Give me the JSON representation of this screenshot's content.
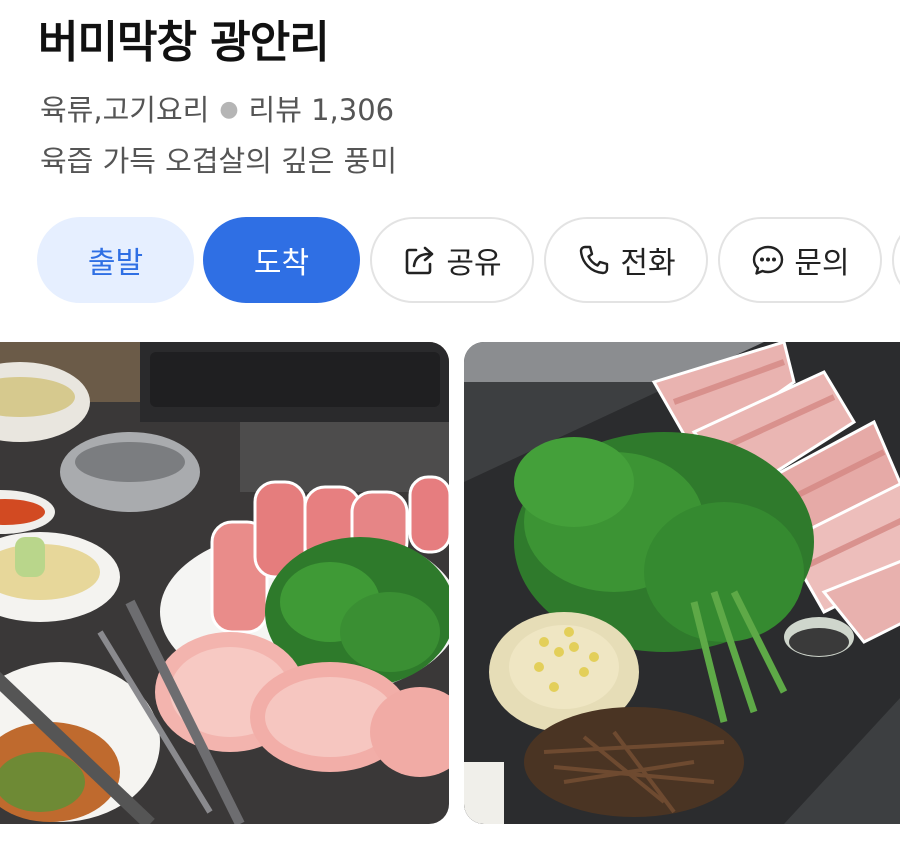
{
  "place": {
    "name": "버미막창 광안리",
    "category": "육류,고기요리",
    "review_label": "리뷰 1,306",
    "description": "육즙 가득 오겹살의 깊은 풍미"
  },
  "actions": {
    "depart": "출발",
    "arrive": "도착",
    "share": "공유",
    "call": "전화",
    "inquiry": "문의"
  },
  "icons": {
    "share": "share-icon",
    "call": "phone-icon",
    "inquiry": "chat-bubble-icon"
  },
  "colors": {
    "primary": "#2f6fe4",
    "primary_light": "#e6efff"
  }
}
